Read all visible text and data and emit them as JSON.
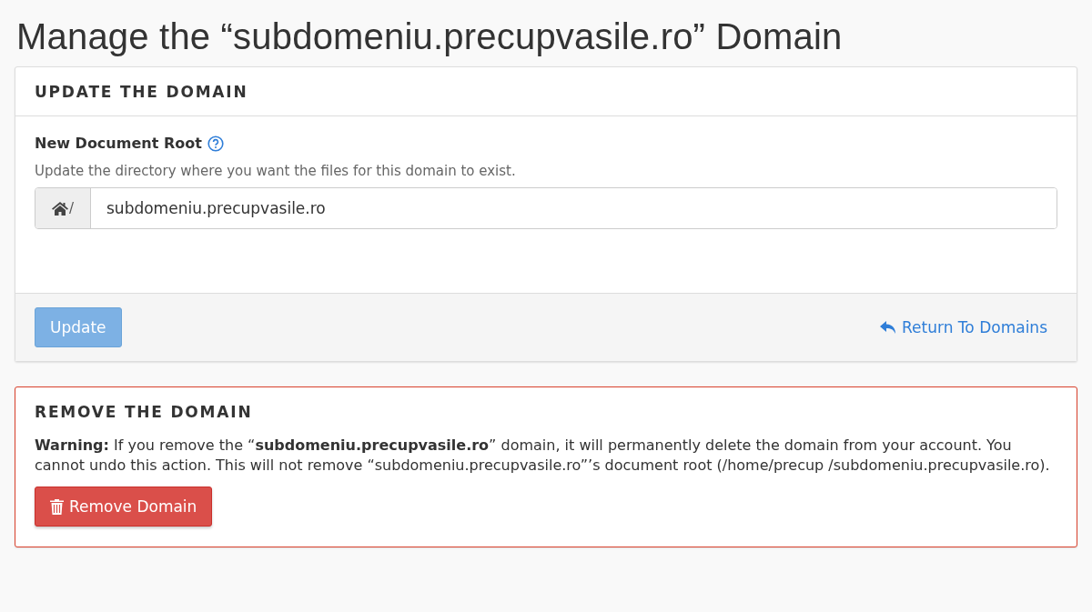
{
  "page_title": "Manage the “subdomeniu.precupvasile.ro” Domain",
  "update_panel": {
    "heading": "UPDATE THE DOMAIN",
    "field_label": "New Document Root",
    "help_text": "Update the directory where you want the files for this domain to exist.",
    "path_prefix": "/",
    "value": "subdomeniu.precupvasile.ro",
    "update_button": {
      "label": "Update",
      "disabled": true
    },
    "return_link": "Return To Domains"
  },
  "remove_panel": {
    "heading": "REMOVE THE DOMAIN",
    "warning": "**Warning:** If you remove the “**subdomeniu.precupvasile.ro**” domain, it will permanently delete the domain from your account. You cannot undo this action. This will not remove “subdomeniu.precupvasile.ro”’s document root (/home/precup /subdomeniu.precupvasile.ro).",
    "remove_button": "Remove Domain"
  }
}
